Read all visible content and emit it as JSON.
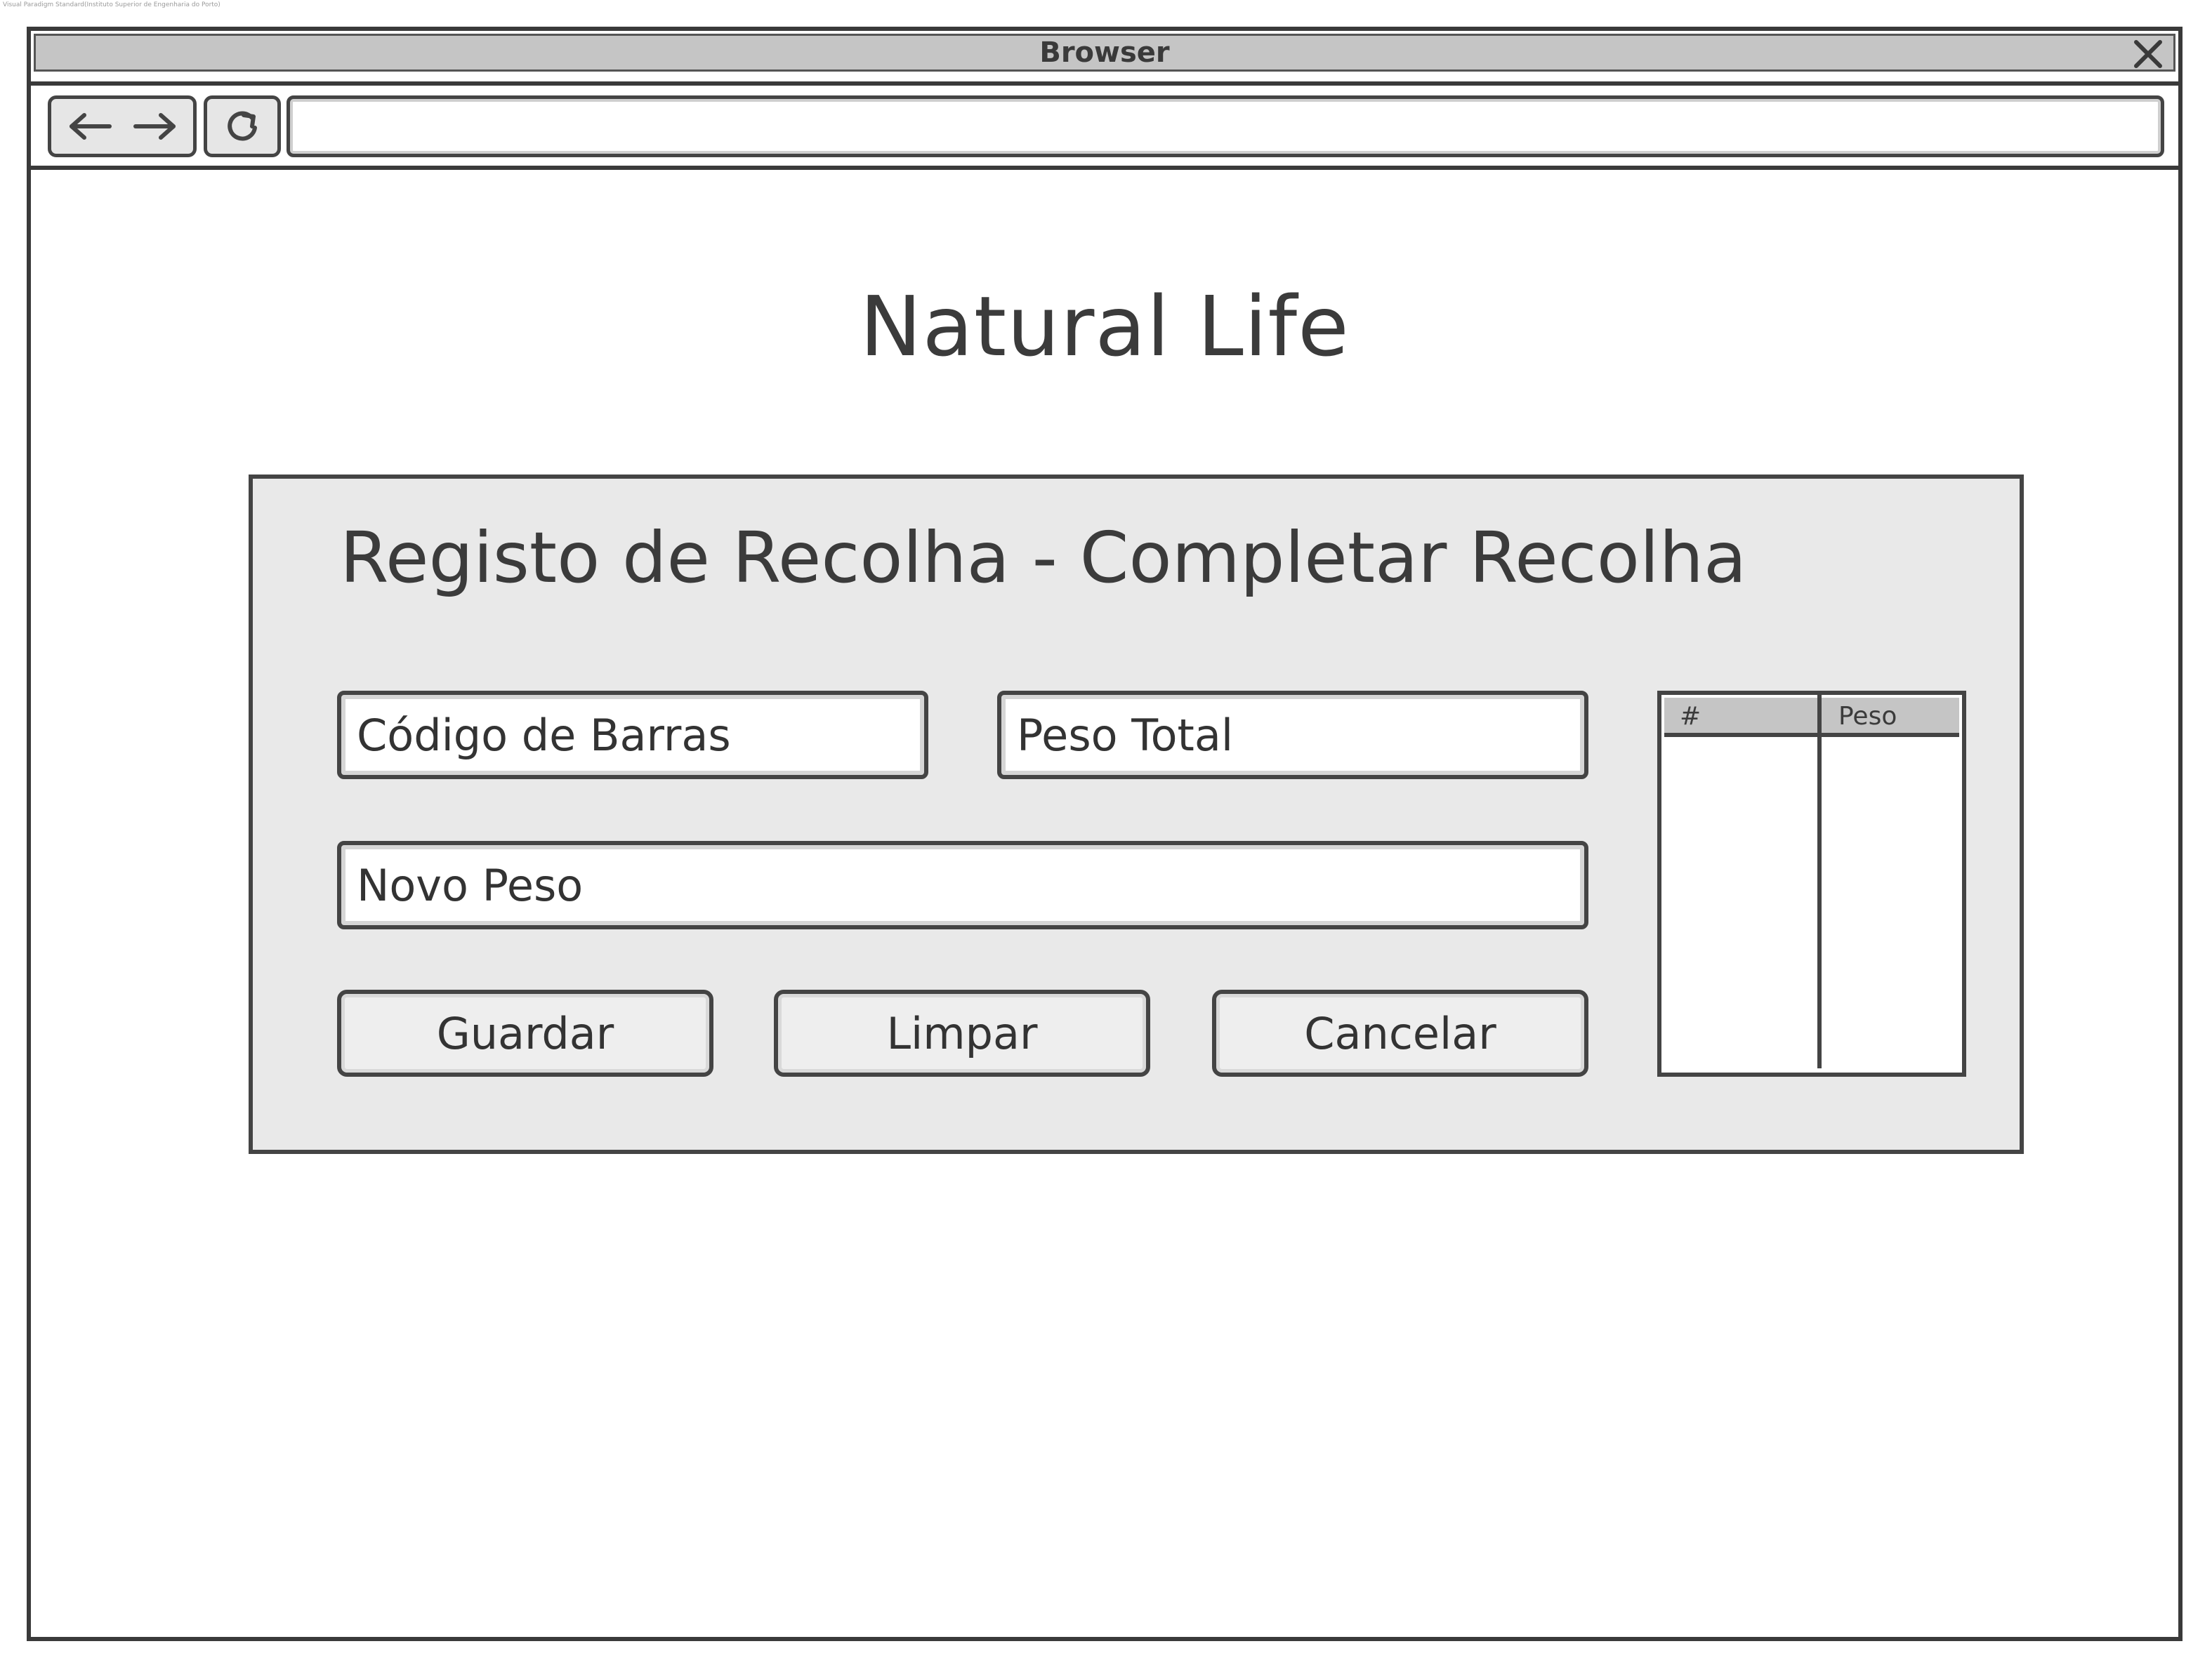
{
  "watermark": "Visual Paradigm Standard(Instituto Superior de Engenharia do Porto)",
  "window": {
    "title": "Browser",
    "close_icon": "close-icon",
    "back_icon": "arrow-left-icon",
    "forward_icon": "arrow-right-icon",
    "reload_icon": "reload-icon",
    "address_value": ""
  },
  "page": {
    "app_title": "Natural Life",
    "panel_title": "Registo de Recolha - Completar Recolha",
    "fields": {
      "barcode_placeholder": "Código de Barras",
      "total_weight_placeholder": "Peso Total",
      "new_weight_placeholder": "Novo Peso"
    },
    "buttons": {
      "save": "Guardar",
      "clear": "Limpar",
      "cancel": "Cancelar"
    },
    "table": {
      "columns": [
        "#",
        "Peso"
      ],
      "rows": []
    }
  },
  "colors": {
    "frame": "#3a3a3a",
    "panel_bg": "#e9e9e9",
    "header_bg": "#c5c5c5"
  }
}
